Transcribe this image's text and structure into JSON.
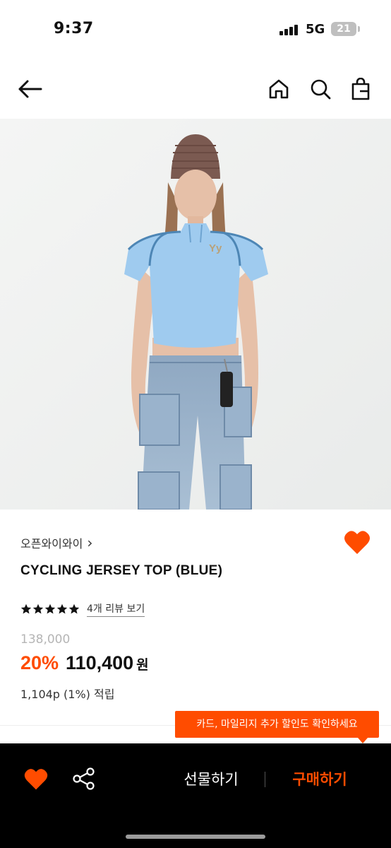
{
  "status_bar": {
    "time": "9:37",
    "network": "5G",
    "battery": "21",
    "icons": [
      "signal-icon",
      "battery-icon"
    ]
  },
  "nav": {
    "icons": [
      "back-arrow-icon",
      "home-icon",
      "search-icon",
      "shopping-bag-icon"
    ]
  },
  "product": {
    "brand": "오픈와이와이",
    "brand_chevron": "›",
    "title": "CYCLING JERSEY TOP (BLUE)",
    "rating_stars": 5,
    "review_link": "4개 리뷰 보기",
    "original_price": "138,000",
    "discount": "20%",
    "sale_price": "110,400",
    "currency": "원",
    "points": "1,104p (1%) 적립",
    "wishlisted": true
  },
  "tooltip": {
    "text": "카드, 마일리지 추가 할인도 확인하세요"
  },
  "bottom_bar": {
    "gift_label": "선물하기",
    "buy_label": "구매하기",
    "icons": [
      "heart-icon",
      "share-icon"
    ]
  },
  "colors": {
    "accent": "#ff4c00",
    "bottom_bar_bg": "#000000",
    "text": "#111111",
    "muted": "#b5b5b5"
  }
}
